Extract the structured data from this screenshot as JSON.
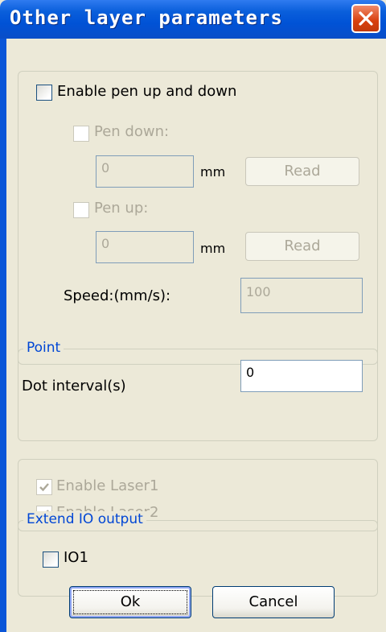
{
  "dialog": {
    "title": "Other layer parameters"
  },
  "pen_section": {
    "enable_label": "Enable pen up and down",
    "pen_down": {
      "label": "Pen down:",
      "value": "0",
      "unit": "mm",
      "read_label": "Read"
    },
    "pen_up": {
      "label": "Pen up:",
      "value": "0",
      "unit": "mm",
      "read_label": "Read"
    },
    "speed": {
      "label": "Speed:(mm/s):",
      "value": "100"
    }
  },
  "point_section": {
    "legend": "Point",
    "dot_interval_label": "Dot interval(s)",
    "dot_interval_value": "0"
  },
  "laser_section": {
    "laser1_label": "Enable Laser1",
    "laser2_label": "Enable Laser2"
  },
  "io_section": {
    "legend": "Extend IO output",
    "io1_label": "IO1"
  },
  "buttons": {
    "ok": "Ok",
    "cancel": "Cancel"
  },
  "colors": {
    "titlebar": "#0a5fdb",
    "close": "#d8400e",
    "legend": "#0046d5",
    "disabled_text": "#aca899",
    "dialog_bg": "#ece9d8"
  }
}
